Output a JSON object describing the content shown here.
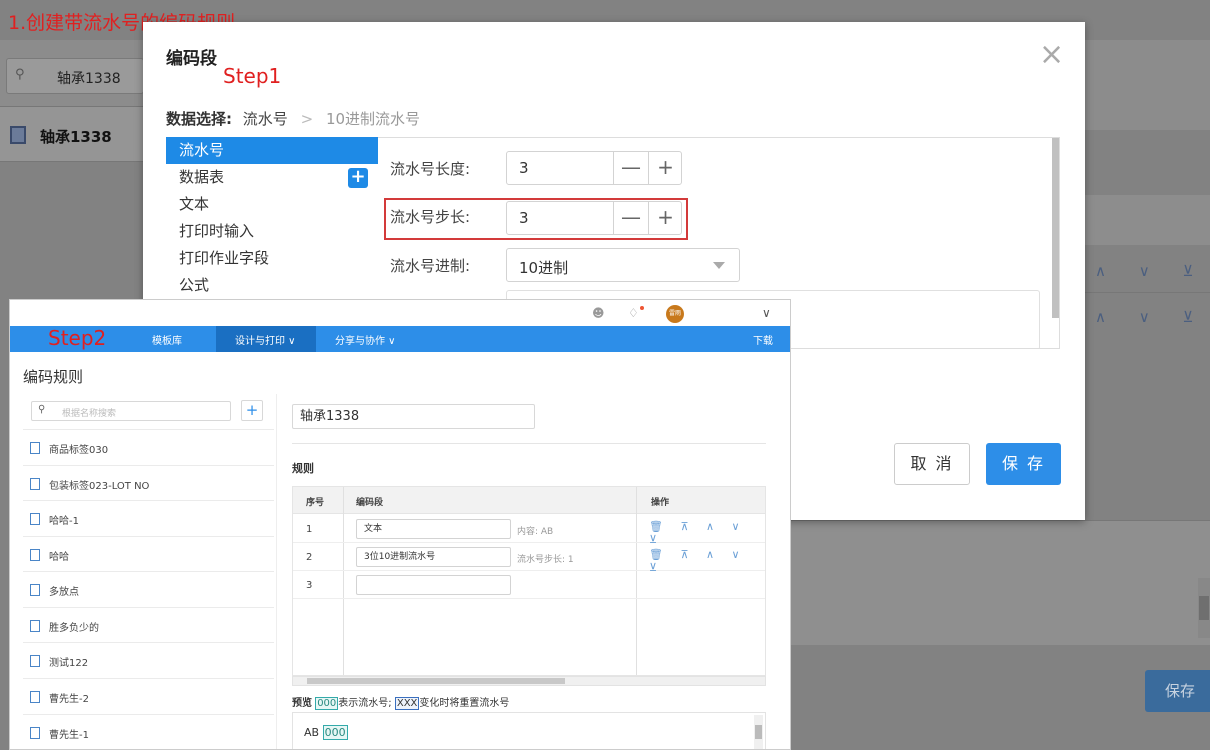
{
  "caption": "1.创建带流水号的编码规则",
  "background": {
    "search_value": "轴承1338",
    "list_item": "轴承1338",
    "arrows": "∧ ∨ ⊻",
    "save_label": "保存"
  },
  "dialog": {
    "title": "编码段",
    "step_label": "Step1",
    "close_symbol": "×",
    "breadcrumb": {
      "label": "数据选择:",
      "item1": "流水号",
      "separator": ">",
      "item2": "10进制流水号"
    },
    "sources": [
      "流水号",
      "数据表",
      "文本",
      "打印时输入",
      "打印作业字段",
      "公式"
    ],
    "add_symbol": "+",
    "fields": {
      "length_label": "流水号长度:",
      "length_value": "3",
      "step_label": "流水号步长:",
      "step_value": "3",
      "base_label": "流水号进制:",
      "base_value": "10进制",
      "minus": "—",
      "plus": "+"
    },
    "cancel_label": "取 消",
    "save_label": "保 存"
  },
  "step2": {
    "step_label": "Step2",
    "nav": [
      "模板库",
      "设计与打印 ∨",
      "分享与协作 ∨",
      "下载"
    ],
    "avatar_text": "雷雨",
    "chevron": "∨",
    "page_title": "编码规则",
    "search_placeholder": "根据名称搜索",
    "add_symbol": "+",
    "rule_list": [
      "商品标签030",
      "包装标签023-LOT NO",
      "哈哈-1",
      "哈哈",
      "多放点",
      "胜多负少的",
      "测试122",
      "曹先生-2",
      "曹先生-1"
    ],
    "rule_name": "轴承1338",
    "rules_heading": "规则",
    "table_headers": {
      "index": "序号",
      "segment": "编码段",
      "actions": "操作"
    },
    "rows": [
      {
        "index": "1",
        "segment": "文本",
        "desc": "内容: AB",
        "ops": "🗑 ⊼ ∧ ∨ ⊻"
      },
      {
        "index": "2",
        "segment": "3位10进制流水号",
        "desc": "流水号步长: 1",
        "ops": "🗑 ⊼ ∧ ∨ ⊻"
      },
      {
        "index": "3",
        "segment": "",
        "desc": "",
        "ops": ""
      }
    ],
    "preview": {
      "label": "预览",
      "tag1": "000",
      "text1": "表示流水号;",
      "tag2": "XXX",
      "text2": "变化时将重置流水号",
      "value_prefix": "AB",
      "value_tag": "000"
    }
  }
}
